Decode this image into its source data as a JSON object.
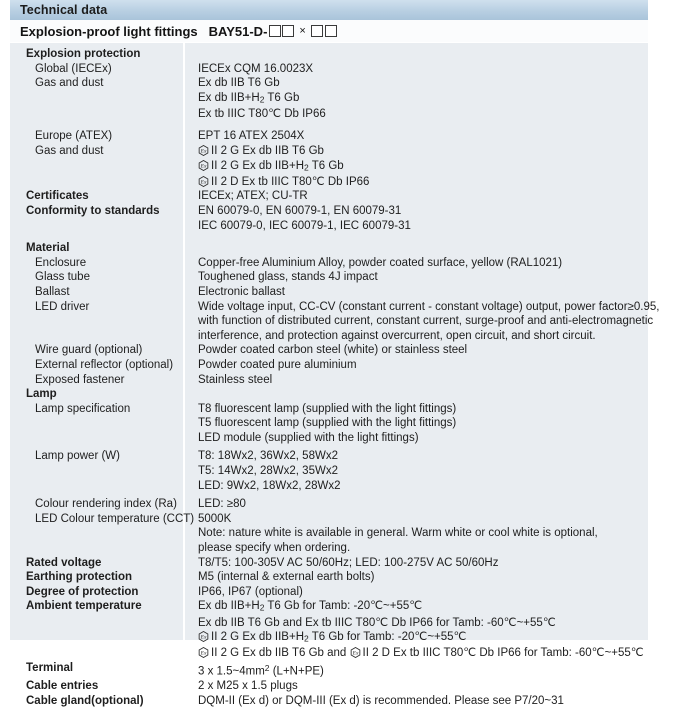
{
  "header": {
    "title": "Technical data",
    "subtitle": "Explosion-proof light fittings",
    "model_prefix": "BAY51-D-",
    "model_separator": "×",
    "placeholder_box_count_left": 2,
    "placeholder_box_count_right": 2
  },
  "colors": {
    "title_bar_top": "#cfe0ee",
    "title_bar_bottom": "#a9c4da",
    "sheet_background": "#e9edf1",
    "divider": "#ffffff",
    "text": "#1e1e1e"
  },
  "icons": {
    "ex_symbol": "atex-ex-hexagon-icon"
  },
  "rows": [
    {
      "id": "explosion-protection",
      "label": "Explosion protection",
      "level": 0,
      "values": []
    },
    {
      "id": "global-iecex",
      "label": "Global (IECEx)",
      "level": 1,
      "values": [
        "IECEx CQM 16.0023X"
      ]
    },
    {
      "id": "gas-and-dust-iecex",
      "label": "Gas and dust",
      "level": 1,
      "values": [
        "Ex db IIB T6 Gb",
        "Ex db IIB+H2 T6 Gb",
        "Ex tb IIIC T80℃ Db IP66"
      ]
    },
    {
      "id": "europe-atex",
      "label": "Europe (ATEX)",
      "level": 1,
      "values": [
        "EPT 16 ATEX 2504X"
      ]
    },
    {
      "id": "gas-and-dust-atex",
      "label": "Gas and dust",
      "level": 1,
      "values": [
        "II 2 G Ex db IIB T6 Gb",
        "II 2 G Ex db IIB+H2 T6 Gb",
        "II 2 D Ex tb IIIC T80℃ Db IP66"
      ]
    },
    {
      "id": "certificates",
      "label": "Certificates",
      "level": 0,
      "values": [
        "IECEx; ATEX; CU-TR"
      ]
    },
    {
      "id": "conformity-to-standards",
      "label": "Conformity to standards",
      "level": 0,
      "values": [
        "EN 60079-0, EN 60079-1, EN 60079-31",
        "IEC 60079-0, IEC 60079-1, IEC 60079-31"
      ]
    },
    {
      "id": "material",
      "label": "Material",
      "level": 0,
      "values": []
    },
    {
      "id": "enclosure",
      "label": "Enclosure",
      "level": 1,
      "values": [
        "Copper-free Aluminium Alloy, powder coated surface, yellow (RAL1021)"
      ]
    },
    {
      "id": "glass-tube",
      "label": "Glass tube",
      "level": 1,
      "values": [
        "Toughened glass, stands 4J impact"
      ]
    },
    {
      "id": "ballast",
      "label": "Ballast",
      "level": 1,
      "values": [
        "Electronic ballast"
      ]
    },
    {
      "id": "led-driver",
      "label": "LED driver",
      "level": 1,
      "values": [
        "Wide voltage input, CC-CV (constant current - constant voltage) output, power factor≥0.95,",
        "with function of distributed current, constant current, surge-proof and anti-electromagnetic",
        "interference, and protection against overcurrent, open circuit, and short circuit."
      ]
    },
    {
      "id": "wire-guard",
      "label": "Wire guard (optional)",
      "level": 1,
      "values": [
        "Powder coated carbon steel (white) or stainless steel"
      ]
    },
    {
      "id": "external-reflector",
      "label": "External reflector (optional)",
      "level": 1,
      "values": [
        "Powder coated pure aluminium"
      ]
    },
    {
      "id": "exposed-fastener",
      "label": "Exposed fastener",
      "level": 1,
      "values": [
        "Stainless steel"
      ]
    },
    {
      "id": "lamp",
      "label": "Lamp",
      "level": 0,
      "values": []
    },
    {
      "id": "lamp-specification",
      "label": "Lamp specification",
      "level": 1,
      "values": [
        "T8 fluorescent lamp (supplied with the light fittings)",
        "T5 fluorescent lamp (supplied with the light fittings)",
        "LED module (supplied with the light fittings)"
      ]
    },
    {
      "id": "lamp-power",
      "label": "Lamp power (W)",
      "level": 1,
      "values": [
        "T8: 18Wx2, 36Wx2, 58Wx2",
        "T5: 14Wx2, 28Wx2, 35Wx2",
        "LED: 9Wx2, 18Wx2, 28Wx2"
      ]
    },
    {
      "id": "colour-rendering-index",
      "label": "Colour rendering index (Ra)",
      "level": 1,
      "values": [
        "LED: ≥80"
      ]
    },
    {
      "id": "led-colour-temperature",
      "label": "LED Colour temperature (CCT)",
      "level": 1,
      "values": [
        "5000K",
        "Note: nature white is available in general. Warm white or cool white is optional,",
        "please specify when ordering."
      ]
    },
    {
      "id": "rated-voltage",
      "label": "Rated voltage",
      "level": 0,
      "values": [
        "T8/T5: 100-305V AC 50/60Hz; LED: 100-275V AC 50/60Hz"
      ]
    },
    {
      "id": "earthing-protection",
      "label": "Earthing protection",
      "level": 0,
      "values": [
        "M5 (internal & external earth bolts)"
      ]
    },
    {
      "id": "degree-of-protection",
      "label": "Degree of protection",
      "level": 0,
      "values": [
        "IP66, IP67 (optional)"
      ]
    },
    {
      "id": "ambient-temperature",
      "label": "Ambient temperature",
      "level": 0,
      "values": [
        "Ex db IIB+H2 T6 Gb for Tamb: -20℃~+55℃",
        "Ex db IIB T6 Gb and Ex tb IIIC T80℃ Db IP66 for Tamb: -60℃~+55℃",
        "II 2 G Ex db IIB+H2 T6 Gb for Tamb: -20℃~+55℃",
        "II 2 G Ex db IIB T6 Gb and II 2 D Ex tb IIIC T80℃ Db IP66 for Tamb: -60℃~+55℃"
      ]
    },
    {
      "id": "terminal",
      "label": "Terminal",
      "level": 0,
      "values": [
        "3 x 1.5~4mm2 (L+N+PE)"
      ]
    },
    {
      "id": "cable-entries",
      "label": "Cable entries",
      "level": 0,
      "values": [
        "2 x M25 x 1.5 plugs"
      ]
    },
    {
      "id": "cable-gland",
      "label": "Cable gland(optional)",
      "level": 0,
      "values": [
        "DQM-II (Ex d) or DQM-III (Ex d) is recommended. Please see P7/20~31"
      ]
    }
  ]
}
